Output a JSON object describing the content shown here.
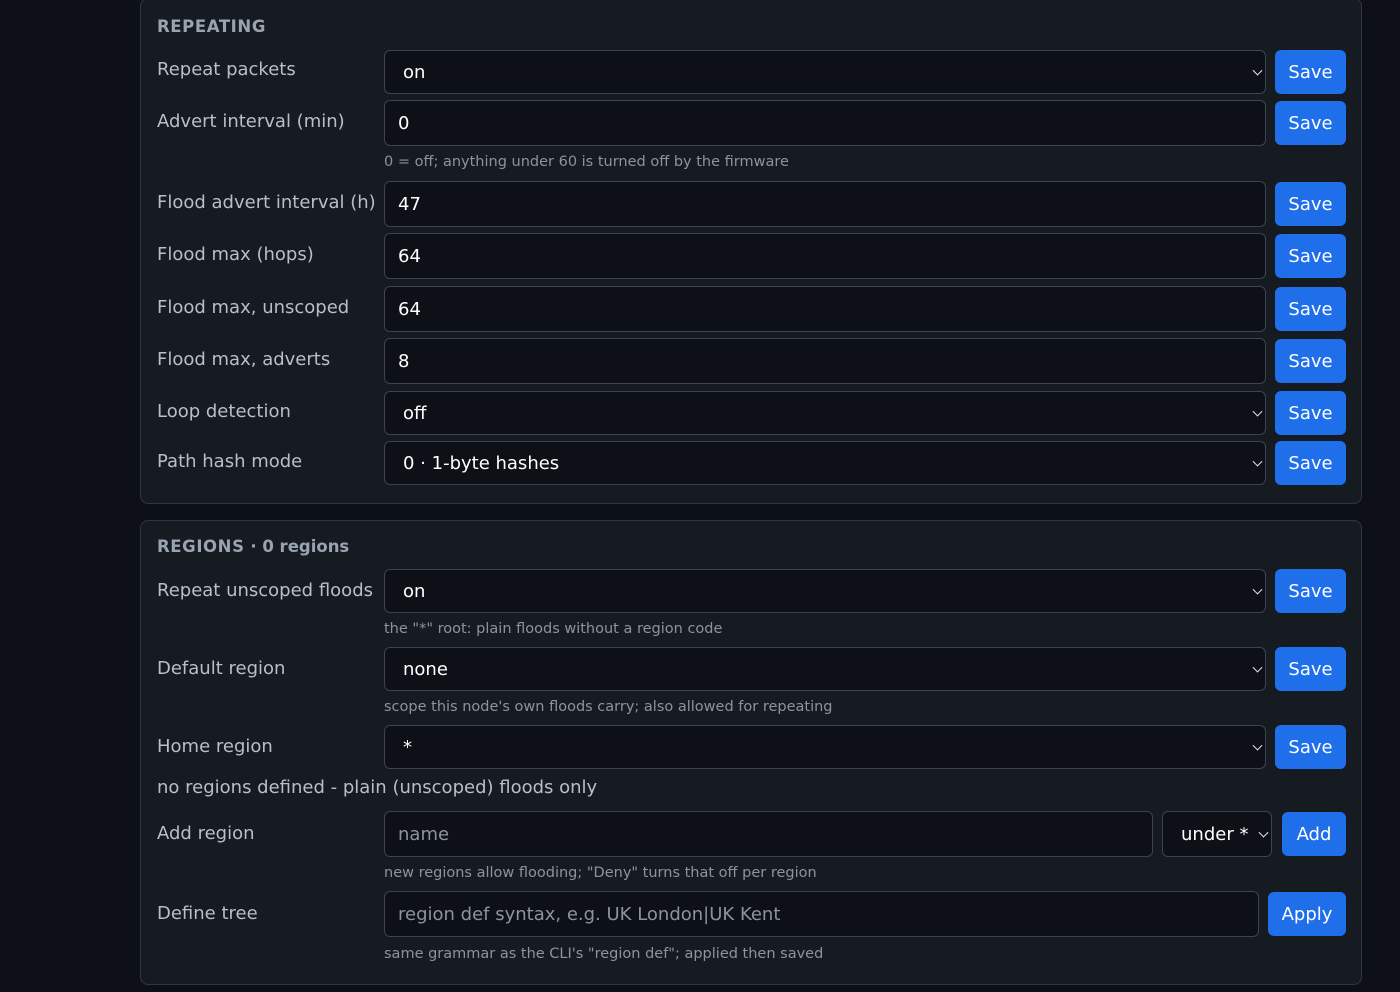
{
  "repeating": {
    "heading": "REPEATING",
    "rows": [
      {
        "label": "Repeat packets",
        "value": "on",
        "button": "Save"
      },
      {
        "label": "Advert interval (min)",
        "value": "0",
        "button": "Save",
        "hint": "0 = off; anything under 60 is turned off by the firmware"
      },
      {
        "label": "Flood advert interval (h)",
        "value": "47",
        "button": "Save"
      },
      {
        "label": "Flood max (hops)",
        "value": "64",
        "button": "Save"
      },
      {
        "label": "Flood max, unscoped",
        "value": "64",
        "button": "Save"
      },
      {
        "label": "Flood max, adverts",
        "value": "8",
        "button": "Save"
      },
      {
        "label": "Loop detection",
        "value": "off",
        "button": "Save"
      },
      {
        "label": "Path hash mode",
        "value": "0 · 1-byte hashes",
        "button": "Save"
      }
    ]
  },
  "regions": {
    "heading": "REGIONS",
    "heading_count": " · 0 regions",
    "rows": [
      {
        "label": "Repeat unscoped floods",
        "value": "on",
        "button": "Save",
        "hint": "the \"*\" root: plain floods without a region code"
      },
      {
        "label": "Default region",
        "value": "none",
        "button": "Save",
        "hint": "scope this node's own floods carry; also allowed for repeating"
      },
      {
        "label": "Home region",
        "value": "*",
        "button": "Save"
      }
    ],
    "notice": "no regions defined - plain (unscoped) floods only",
    "add_region": {
      "label": "Add region",
      "placeholder": "name",
      "parent_select": "under *",
      "button": "Add",
      "hint": "new regions allow flooding; \"Deny\" turns that off per region"
    },
    "define_tree": {
      "label": "Define tree",
      "placeholder": "region def syntax, e.g. UK London|UK Kent",
      "button": "Apply",
      "hint": "same grammar as the CLI's \"region def\"; applied then saved"
    }
  },
  "colors": {
    "background": "#0d1117",
    "panel": "#161b22",
    "accent": "#1f6feb"
  }
}
